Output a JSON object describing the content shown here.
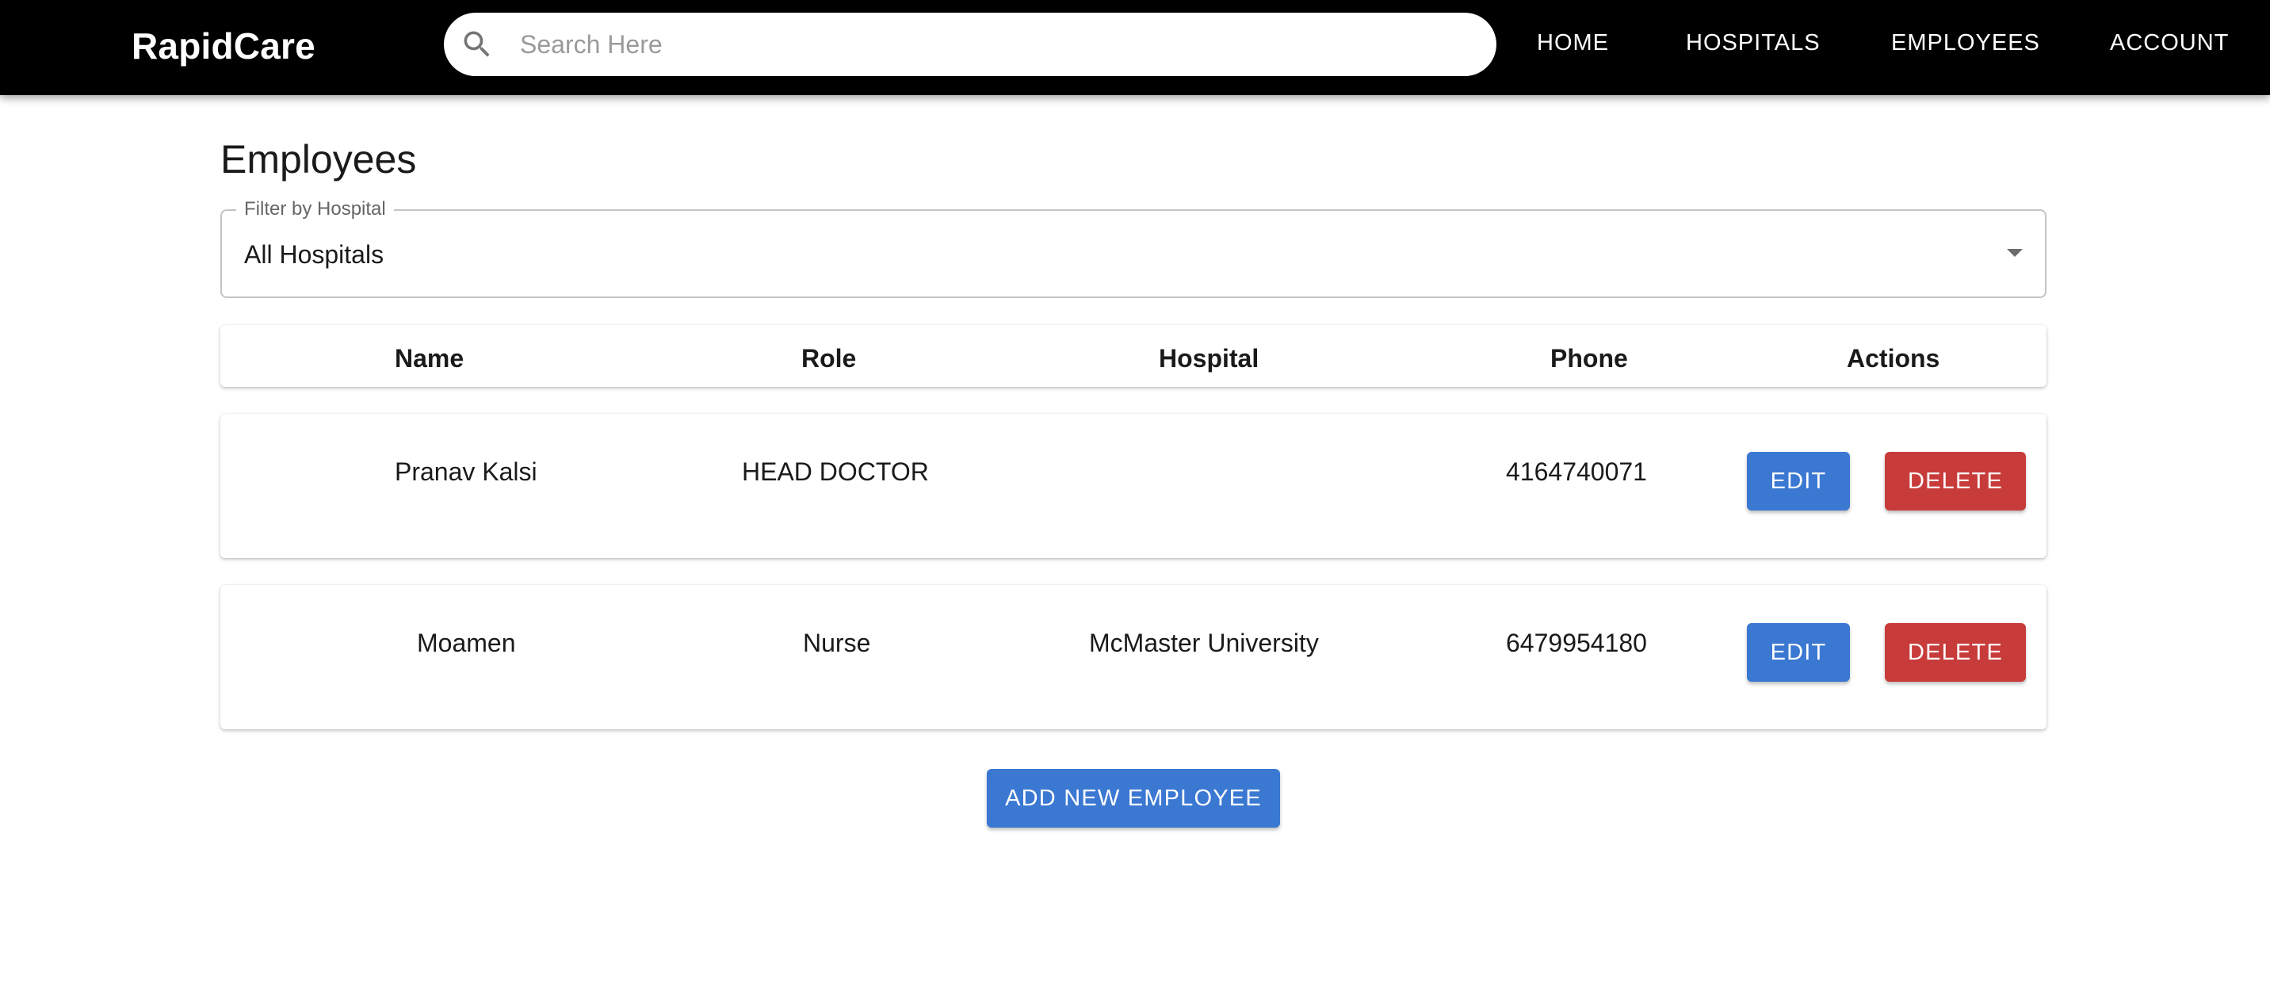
{
  "header": {
    "brand": "RapidCare",
    "search": {
      "placeholder": "Search Here",
      "value": "",
      "icon": "search-icon"
    },
    "nav": [
      "HOME",
      "HOSPITALS",
      "EMPLOYEES",
      "ACCOUNT"
    ]
  },
  "main": {
    "title": "Employees",
    "filter": {
      "label": "Filter by Hospital",
      "value": "All Hospitals",
      "icon": "dropdown-arrow-icon"
    },
    "table": {
      "columns": [
        "Name",
        "Role",
        "Hospital",
        "Phone",
        "Actions"
      ],
      "rows": [
        {
          "name": "Pranav Kalsi",
          "role": "HEAD DOCTOR",
          "hospital": "",
          "phone": "4164740071",
          "edit_label": "EDIT",
          "delete_label": "DELETE"
        },
        {
          "name": "Moamen",
          "role": "Nurse",
          "hospital": "McMaster University",
          "phone": "6479954180",
          "edit_label": "EDIT",
          "delete_label": "DELETE"
        }
      ]
    },
    "add_button": "ADD NEW EMPLOYEE"
  },
  "colors": {
    "appbar": "#000000",
    "primary": "#3a78d2",
    "danger": "#c73c3a",
    "outline": "#c4c4c4"
  }
}
